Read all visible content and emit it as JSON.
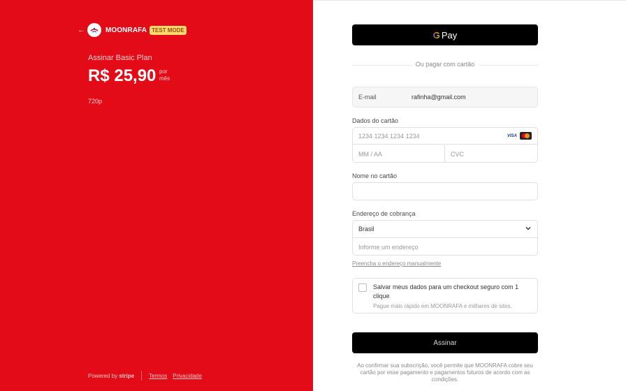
{
  "brand": {
    "back_icon": "arrow-left-icon",
    "name": "MOONRAFA",
    "badge": "TEST MODE"
  },
  "summary": {
    "plan_label": "Assinar Basic Plan",
    "price": "R$ 25,90",
    "period_line1": "por",
    "period_line2": "mês",
    "description": "720p"
  },
  "footer": {
    "powered_by": "Powered by",
    "stripe": "stripe",
    "terms": "Termos",
    "privacy": "Privacidade"
  },
  "payment": {
    "gpay_g": "G",
    "gpay_label": "Pay",
    "divider": "Ou pagar com cartão",
    "email_label": "E-mail",
    "email_value": "rafinha@gmail.com",
    "card_label": "Dados do cartão",
    "card_number_placeholder": "1234 1234 1234 1234",
    "card_brands": [
      "VISA",
      "mastercard"
    ],
    "expiry_placeholder": "MM / AA",
    "cvc_placeholder": "CVC",
    "name_label": "Nome no cartão",
    "name_value": "",
    "address_label": "Endereço de cobrança",
    "country": "Brasil",
    "address_placeholder": "Informe um endereço",
    "manual_link": "Preencha o endereço manualmente",
    "save_title": "Salvar meus dados para um checkout seguro com 1 clique",
    "save_sub": "Pague mais rápido em MOONRAFA e milhares de sites.",
    "save_checked": false,
    "submit_label": "Assinar",
    "terms_text": "Ao confirmar sua subscrição, você permite que MOONRAFA cobre seu cartão por esse pagamento e pagamentos futuros de acordo com as condições."
  },
  "colors": {
    "left_background": "#e30b17",
    "badge_background": "#fedb6f",
    "button_background": "#000000"
  }
}
